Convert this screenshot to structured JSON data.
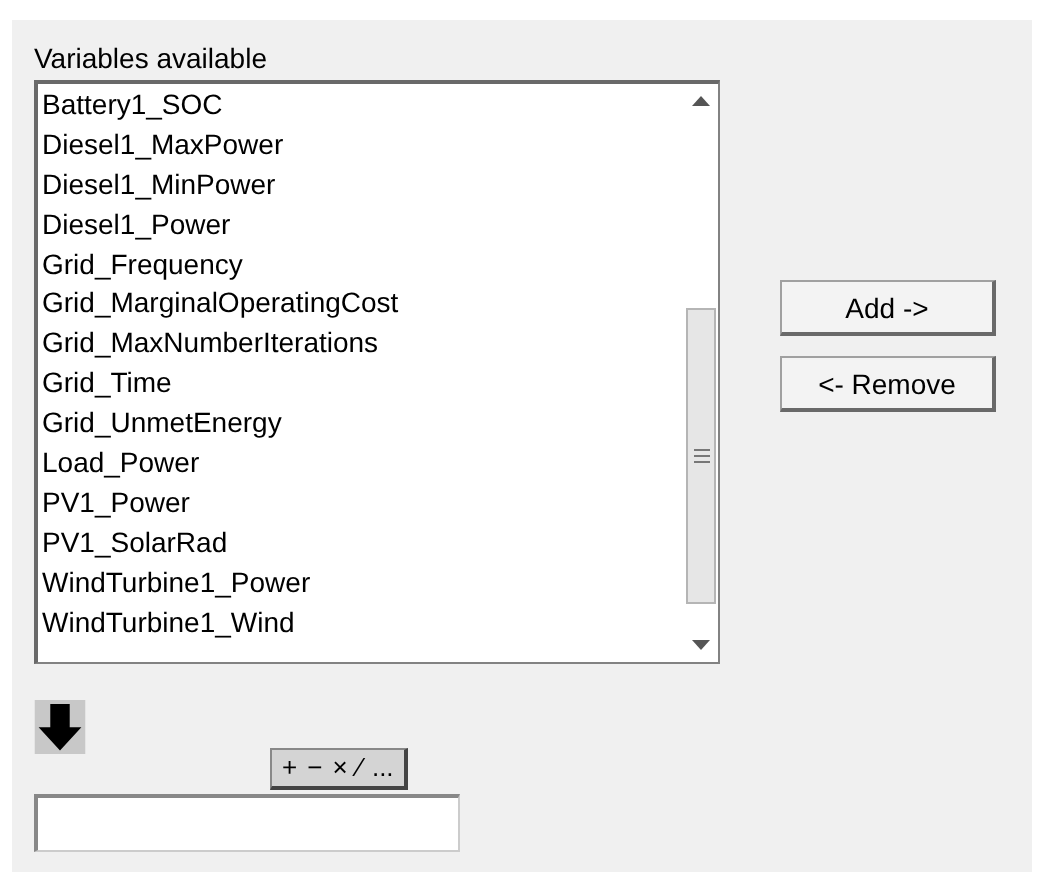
{
  "section_label": "Variables available",
  "variables": [
    {
      "name": "Battery1_SOC",
      "selected": false
    },
    {
      "name": "Diesel1_MaxPower",
      "selected": false
    },
    {
      "name": "Diesel1_MinPower",
      "selected": false
    },
    {
      "name": "Diesel1_Power",
      "selected": false
    },
    {
      "name": "Grid_Frequency",
      "selected": false
    },
    {
      "name": "Grid_MarginalOperatingCost",
      "selected": false
    },
    {
      "name": "Grid_MaxNumberIterations",
      "selected": false
    },
    {
      "name": "Grid_Time",
      "selected": false
    },
    {
      "name": "Grid_UnmetEnergy",
      "selected": false
    },
    {
      "name": "Load_Power",
      "selected": false
    },
    {
      "name": "PV1_Power",
      "selected": false
    },
    {
      "name": "PV1_SolarRad",
      "selected": false
    },
    {
      "name": "WindTurbine1_Power",
      "selected": false
    },
    {
      "name": "WindTurbine1_Wind",
      "selected": false
    }
  ],
  "buttons": [
    "Add ->",
    "<- Remove"
  ],
  "operators": [
    "+",
    "−",
    "×",
    "⁄",
    "..."
  ]
}
